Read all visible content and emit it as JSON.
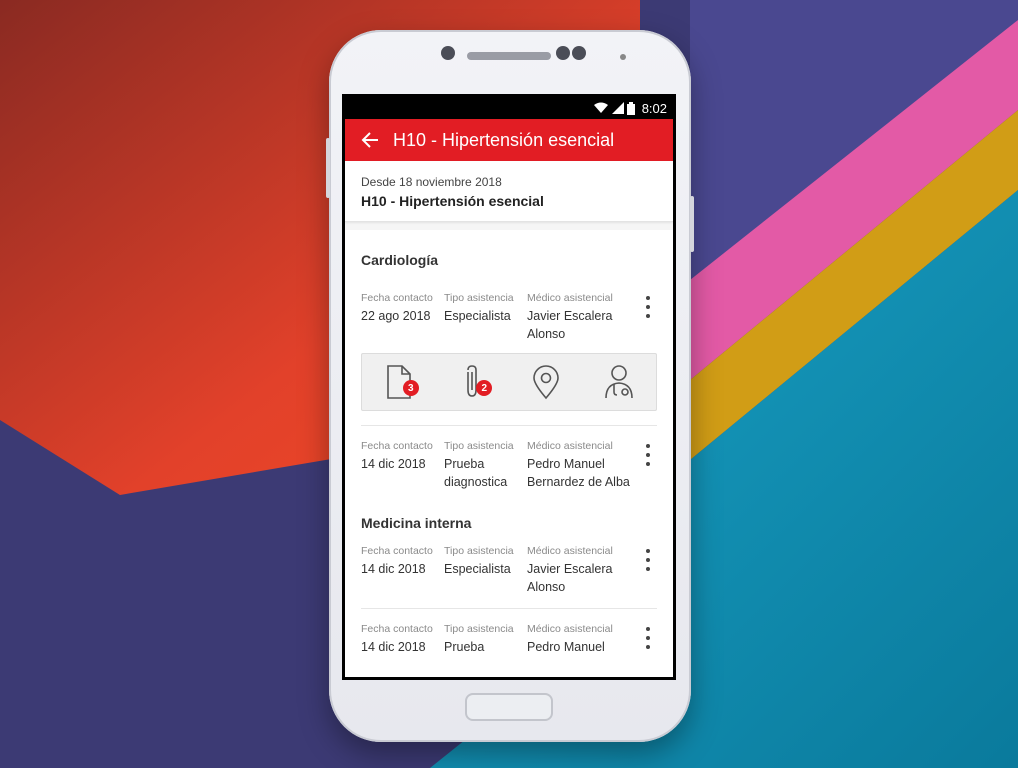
{
  "status_bar": {
    "time": "8:02"
  },
  "app_bar": {
    "title": "H10 - Hipertensión esencial"
  },
  "summary": {
    "since": "Desde 18 noviembre 2018",
    "name": "H10 - Hipertensión esencial"
  },
  "labels": {
    "fecha": "Fecha contacto",
    "tipo": "Tipo asistencia",
    "medico": "Médico asistencial"
  },
  "sections": [
    {
      "title": "Cardiología",
      "records": [
        {
          "fecha": "22 ago 2018",
          "tipo": "Especialista",
          "medico": "Javier Escalera Alonso"
        },
        {
          "fecha": "14 dic 2018",
          "tipo": "Prueba diagnostica",
          "medico": "Pedro Manuel Bernardez de Alba"
        }
      ]
    },
    {
      "title": "Medicina interna",
      "records": [
        {
          "fecha": "14 dic 2018",
          "tipo": "Especialista",
          "medico": "Javier Escalera Alonso"
        },
        {
          "fecha": "14 dic 2018",
          "tipo": "Prueba",
          "medico": "Pedro Manuel"
        }
      ]
    }
  ],
  "actions": [
    {
      "icon": "document-icon",
      "badge": "3"
    },
    {
      "icon": "paperclip-icon",
      "badge": "2"
    },
    {
      "icon": "location-pin-icon"
    },
    {
      "icon": "doctor-icon"
    }
  ],
  "colors": {
    "accent": "#e21d24"
  }
}
